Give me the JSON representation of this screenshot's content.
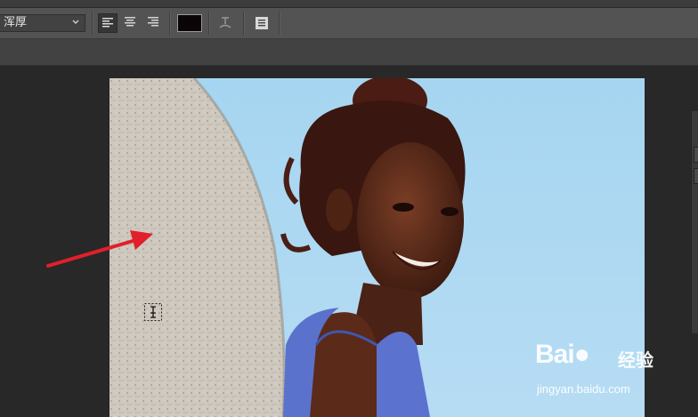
{
  "toolbar": {
    "antialias_value": "浑厚",
    "align_left": "align-left-icon",
    "align_center": "align-center-icon",
    "align_right": "align-right-icon",
    "text_color": "#0c0507",
    "warp_icon": "warp-text-icon",
    "panels_icon": "character-paragraph-panel-icon"
  },
  "canvas": {
    "description_colors": {
      "sky": "#a9d7f2",
      "rock": "#cfc8bd",
      "top": "#5a3728"
    }
  },
  "watermark": {
    "logo": "Bai",
    "logo_suffix": "经验",
    "url": "jingyan.baidu.com"
  },
  "annotation": {
    "arrow_color": "#e0202a"
  }
}
